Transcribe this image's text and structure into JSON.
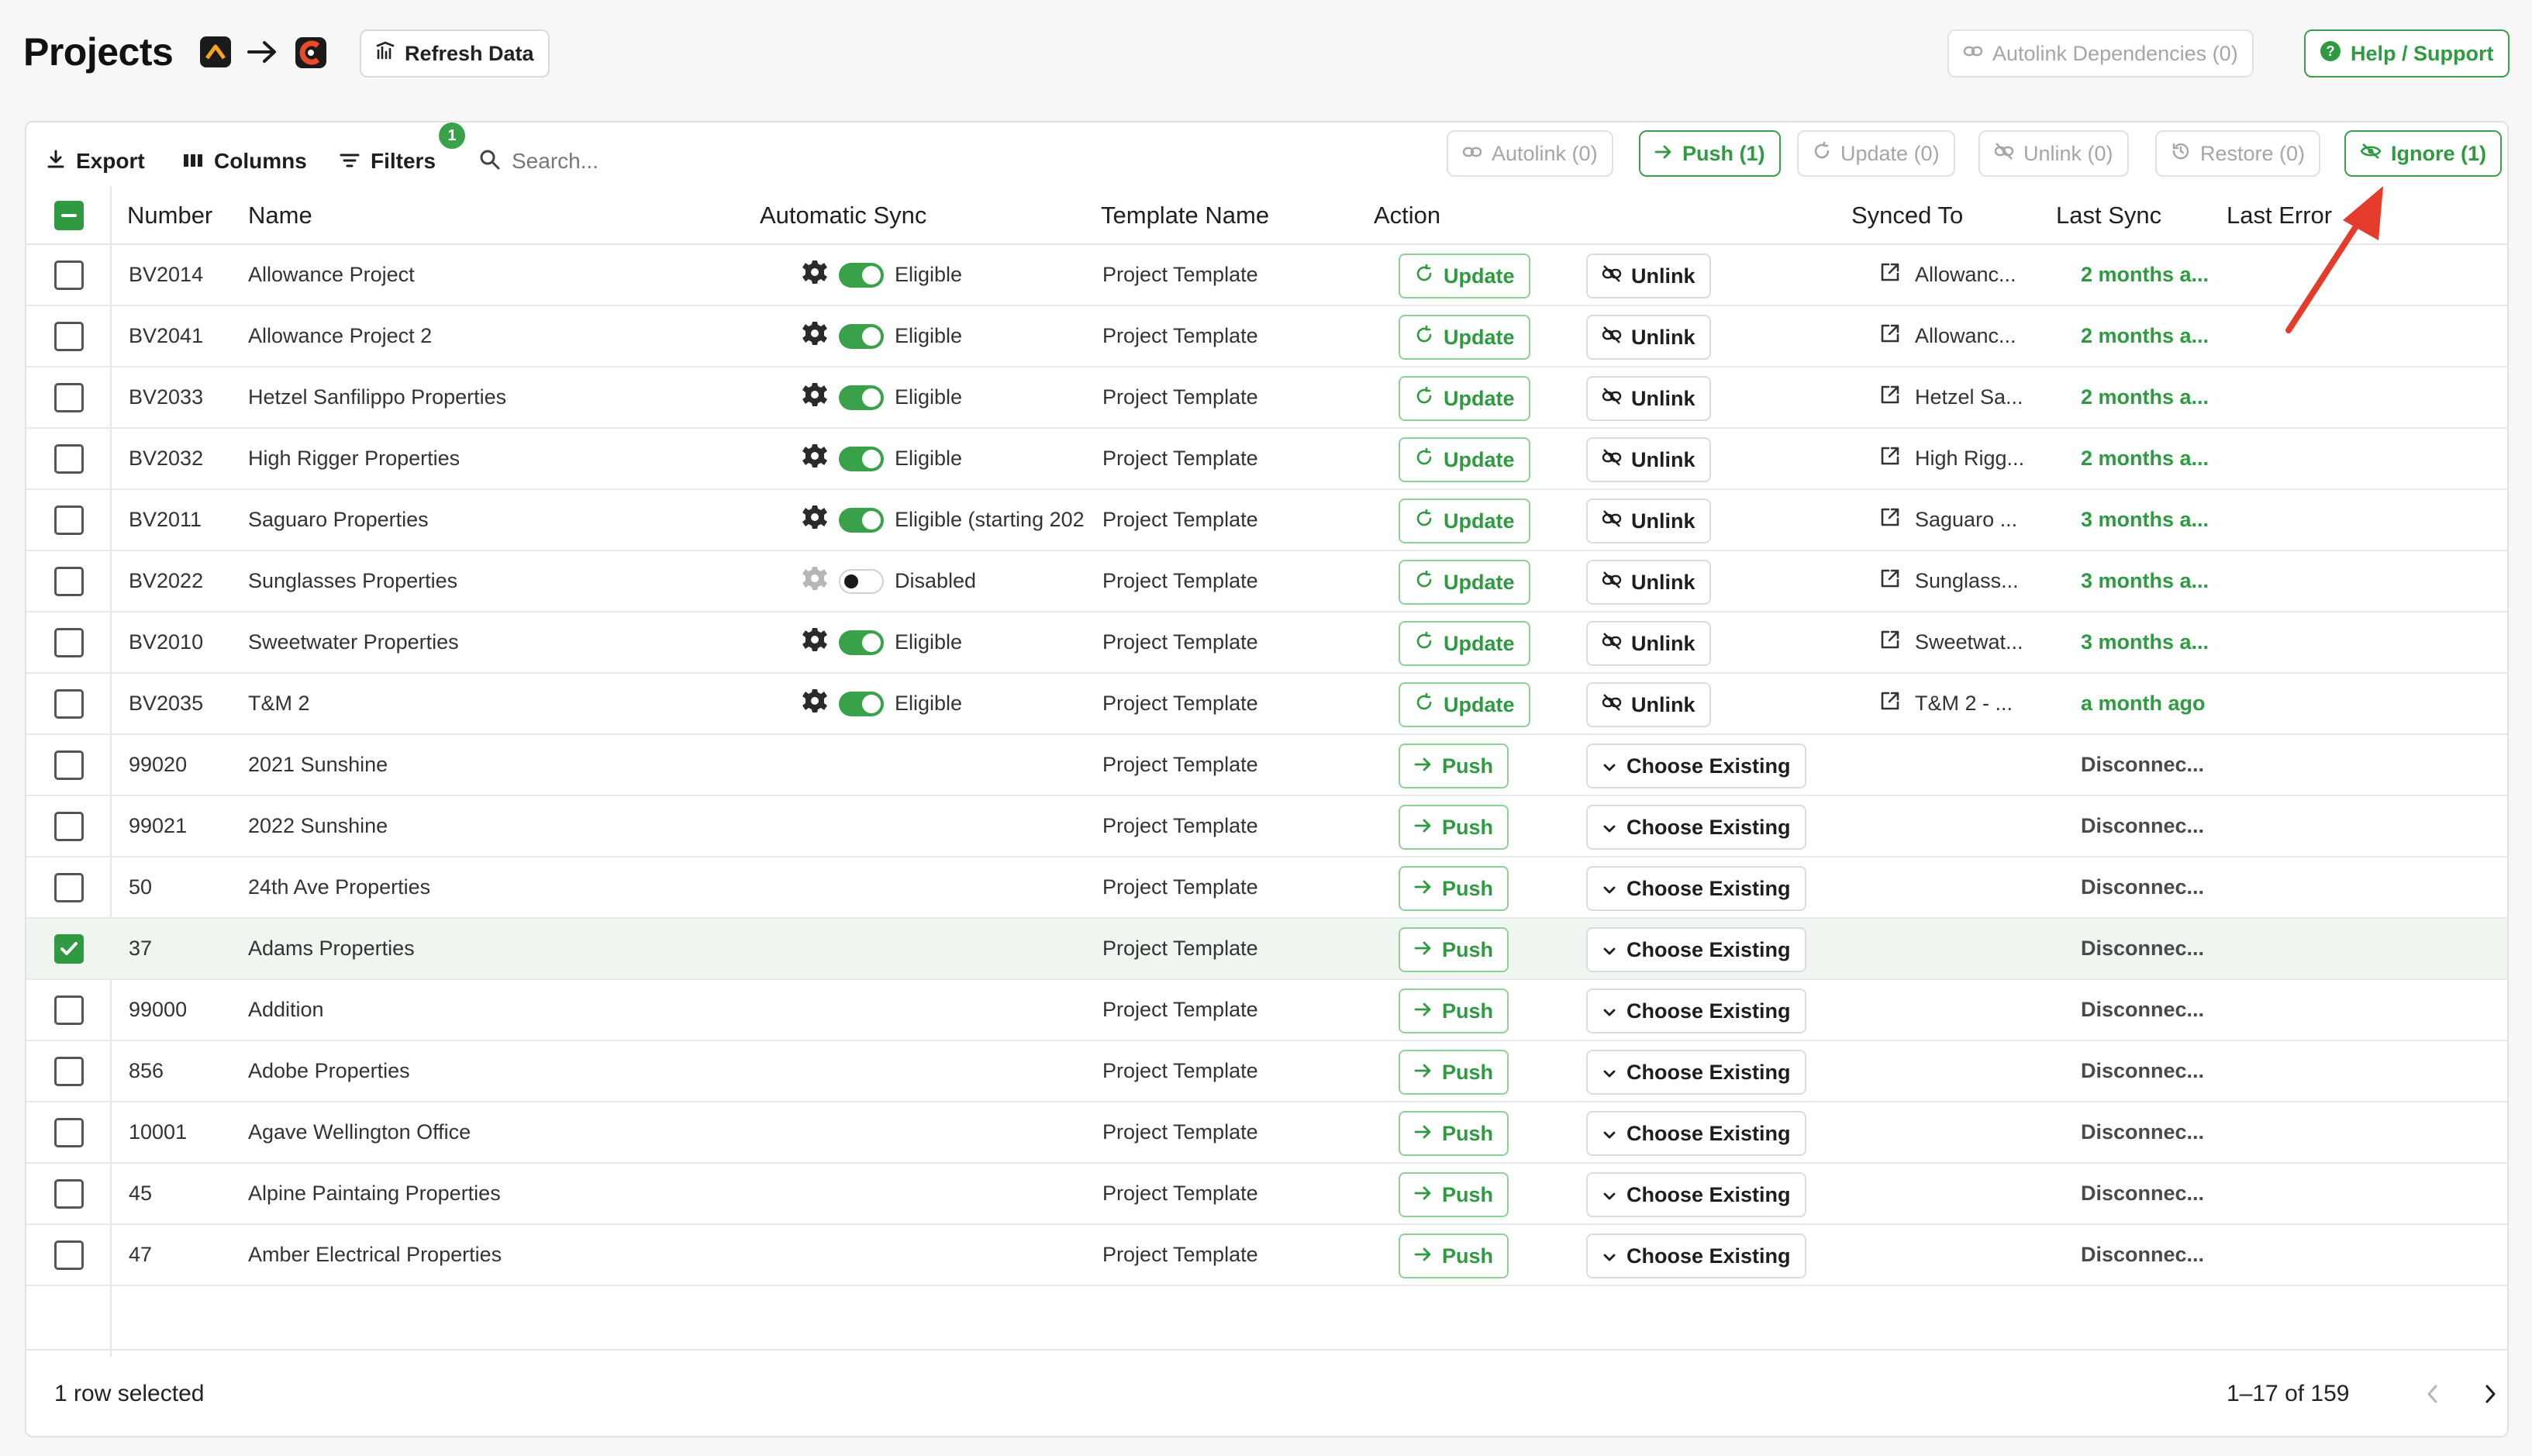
{
  "header": {
    "title": "Projects",
    "refresh_label": "Refresh Data",
    "autolink_deps_label": "Autolink Dependencies (0)",
    "help_label": "Help / Support"
  },
  "toolbar": {
    "export_label": "Export",
    "columns_label": "Columns",
    "filters_label": "Filters",
    "filters_badge": "1",
    "search_placeholder": "Search...",
    "autolink_label": "Autolink (0)",
    "push_label": "Push (1)",
    "update_label": "Update (0)",
    "unlink_label": "Unlink (0)",
    "restore_label": "Restore (0)",
    "ignore_label": "Ignore (1)"
  },
  "columns": {
    "number": "Number",
    "name": "Name",
    "auto_sync": "Automatic Sync",
    "template": "Template Name",
    "action": "Action",
    "synced_to": "Synced To",
    "last_sync": "Last Sync",
    "last_error": "Last Error"
  },
  "rows": [
    {
      "number": "BV2014",
      "name": "Allowance Project",
      "sync": "Eligible",
      "sync_on": true,
      "template": "Project Template",
      "primary": "Update",
      "secondary": "Unlink",
      "synced_to": "Allowanc...",
      "last_sync": "2 months a...",
      "selected": false
    },
    {
      "number": "BV2041",
      "name": "Allowance Project 2",
      "sync": "Eligible",
      "sync_on": true,
      "template": "Project Template",
      "primary": "Update",
      "secondary": "Unlink",
      "synced_to": "Allowanc...",
      "last_sync": "2 months a...",
      "selected": false
    },
    {
      "number": "BV2033",
      "name": "Hetzel Sanfilippo Properties",
      "sync": "Eligible",
      "sync_on": true,
      "template": "Project Template",
      "primary": "Update",
      "secondary": "Unlink",
      "synced_to": "Hetzel Sa...",
      "last_sync": "2 months a...",
      "selected": false
    },
    {
      "number": "BV2032",
      "name": "High Rigger Properties",
      "sync": "Eligible",
      "sync_on": true,
      "template": "Project Template",
      "primary": "Update",
      "secondary": "Unlink",
      "synced_to": "High Rigg...",
      "last_sync": "2 months a...",
      "selected": false
    },
    {
      "number": "BV2011",
      "name": "Saguaro Properties",
      "sync": "Eligible (starting 202",
      "sync_on": true,
      "template": "Project Template",
      "primary": "Update",
      "secondary": "Unlink",
      "synced_to": "Saguaro ...",
      "last_sync": "3 months a...",
      "selected": false
    },
    {
      "number": "BV2022",
      "name": "Sunglasses Properties",
      "sync": "Disabled",
      "sync_on": false,
      "template": "Project Template",
      "primary": "Update",
      "secondary": "Unlink",
      "synced_to": "Sunglass...",
      "last_sync": "3 months a...",
      "selected": false
    },
    {
      "number": "BV2010",
      "name": "Sweetwater Properties",
      "sync": "Eligible",
      "sync_on": true,
      "template": "Project Template",
      "primary": "Update",
      "secondary": "Unlink",
      "synced_to": "Sweetwat...",
      "last_sync": "3 months a...",
      "selected": false
    },
    {
      "number": "BV2035",
      "name": "T&M 2",
      "sync": "Eligible",
      "sync_on": true,
      "template": "Project Template",
      "primary": "Update",
      "secondary": "Unlink",
      "synced_to": "T&M 2 - ...",
      "last_sync": "a month ago",
      "selected": false
    },
    {
      "number": "99020",
      "name": "2021 Sunshine",
      "sync": "",
      "template": "Project Template",
      "primary": "Push",
      "secondary": "Choose Existing",
      "synced_to": "",
      "last_sync": "Disconnec...",
      "selected": false
    },
    {
      "number": "99021",
      "name": "2022 Sunshine",
      "sync": "",
      "template": "Project Template",
      "primary": "Push",
      "secondary": "Choose Existing",
      "synced_to": "",
      "last_sync": "Disconnec...",
      "selected": false
    },
    {
      "number": "50",
      "name": "24th Ave Properties",
      "sync": "",
      "template": "Project Template",
      "primary": "Push",
      "secondary": "Choose Existing",
      "synced_to": "",
      "last_sync": "Disconnec...",
      "selected": false
    },
    {
      "number": "37",
      "name": "Adams Properties",
      "sync": "",
      "template": "Project Template",
      "primary": "Push",
      "secondary": "Choose Existing",
      "synced_to": "",
      "last_sync": "Disconnec...",
      "selected": true
    },
    {
      "number": "99000",
      "name": "Addition",
      "sync": "",
      "template": "Project Template",
      "primary": "Push",
      "secondary": "Choose Existing",
      "synced_to": "",
      "last_sync": "Disconnec...",
      "selected": false
    },
    {
      "number": "856",
      "name": "Adobe Properties",
      "sync": "",
      "template": "Project Template",
      "primary": "Push",
      "secondary": "Choose Existing",
      "synced_to": "",
      "last_sync": "Disconnec...",
      "selected": false
    },
    {
      "number": "10001",
      "name": "Agave Wellington Office",
      "sync": "",
      "template": "Project Template",
      "primary": "Push",
      "secondary": "Choose Existing",
      "synced_to": "",
      "last_sync": "Disconnec...",
      "selected": false
    },
    {
      "number": "45",
      "name": "Alpine Paintaing Properties",
      "sync": "",
      "template": "Project Template",
      "primary": "Push",
      "secondary": "Choose Existing",
      "synced_to": "",
      "last_sync": "Disconnec...",
      "selected": false
    },
    {
      "number": "47",
      "name": "Amber Electrical Properties",
      "sync": "",
      "template": "Project Template",
      "primary": "Push",
      "secondary": "Choose Existing",
      "synced_to": "",
      "last_sync": "Disconnec...",
      "selected": false
    }
  ],
  "footer": {
    "selection": "1 row selected",
    "pagination": "1–17 of 159"
  },
  "colors": {
    "accent": "#2f9a41",
    "annotation_arrow": "#e53b2c"
  }
}
